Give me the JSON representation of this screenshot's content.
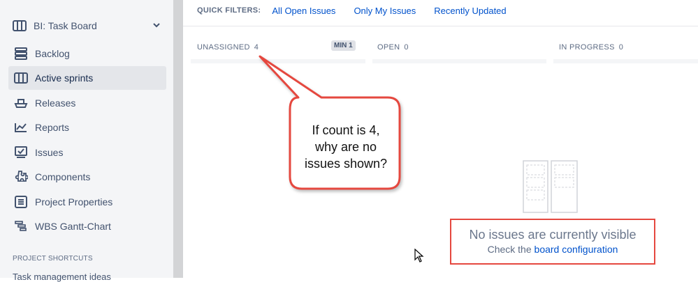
{
  "sidebar": {
    "board_name": "BI: Task Board",
    "items": [
      {
        "label": "Backlog",
        "icon": "backlog-icon",
        "active": false
      },
      {
        "label": "Active sprints",
        "icon": "active-sprints-icon",
        "active": true
      },
      {
        "label": "Releases",
        "icon": "releases-icon",
        "active": false
      },
      {
        "label": "Reports",
        "icon": "reports-icon",
        "active": false
      },
      {
        "label": "Issues",
        "icon": "issues-icon",
        "active": false
      },
      {
        "label": "Components",
        "icon": "components-icon",
        "active": false
      },
      {
        "label": "Project Properties",
        "icon": "project-properties-icon",
        "active": false
      },
      {
        "label": "WBS Gantt-Chart",
        "icon": "gantt-chart-icon",
        "active": false
      }
    ],
    "shortcuts_title": "PROJECT SHORTCUTS",
    "shortcut_item": "Task management ideas"
  },
  "filters": {
    "title": "QUICK FILTERS:",
    "links": [
      "All Open Issues",
      "Only My Issues",
      "Recently Updated"
    ]
  },
  "columns": [
    {
      "title": "UNASSIGNED",
      "count": "4",
      "badge": "MIN 1"
    },
    {
      "title": "OPEN",
      "count": "0"
    },
    {
      "title": "IN PROGRESS",
      "count": "0"
    }
  ],
  "empty_state": {
    "title": "No issues are currently visible",
    "sub_prefix": "Check the",
    "sub_link": "board configuration"
  },
  "callout": {
    "lines": [
      "If count is 4,",
      "why are no",
      "issues shown?"
    ]
  },
  "colors": {
    "accent": "#0052cc",
    "annotation_red": "#e5483f",
    "sidebar_bg": "#f4f5f7"
  }
}
